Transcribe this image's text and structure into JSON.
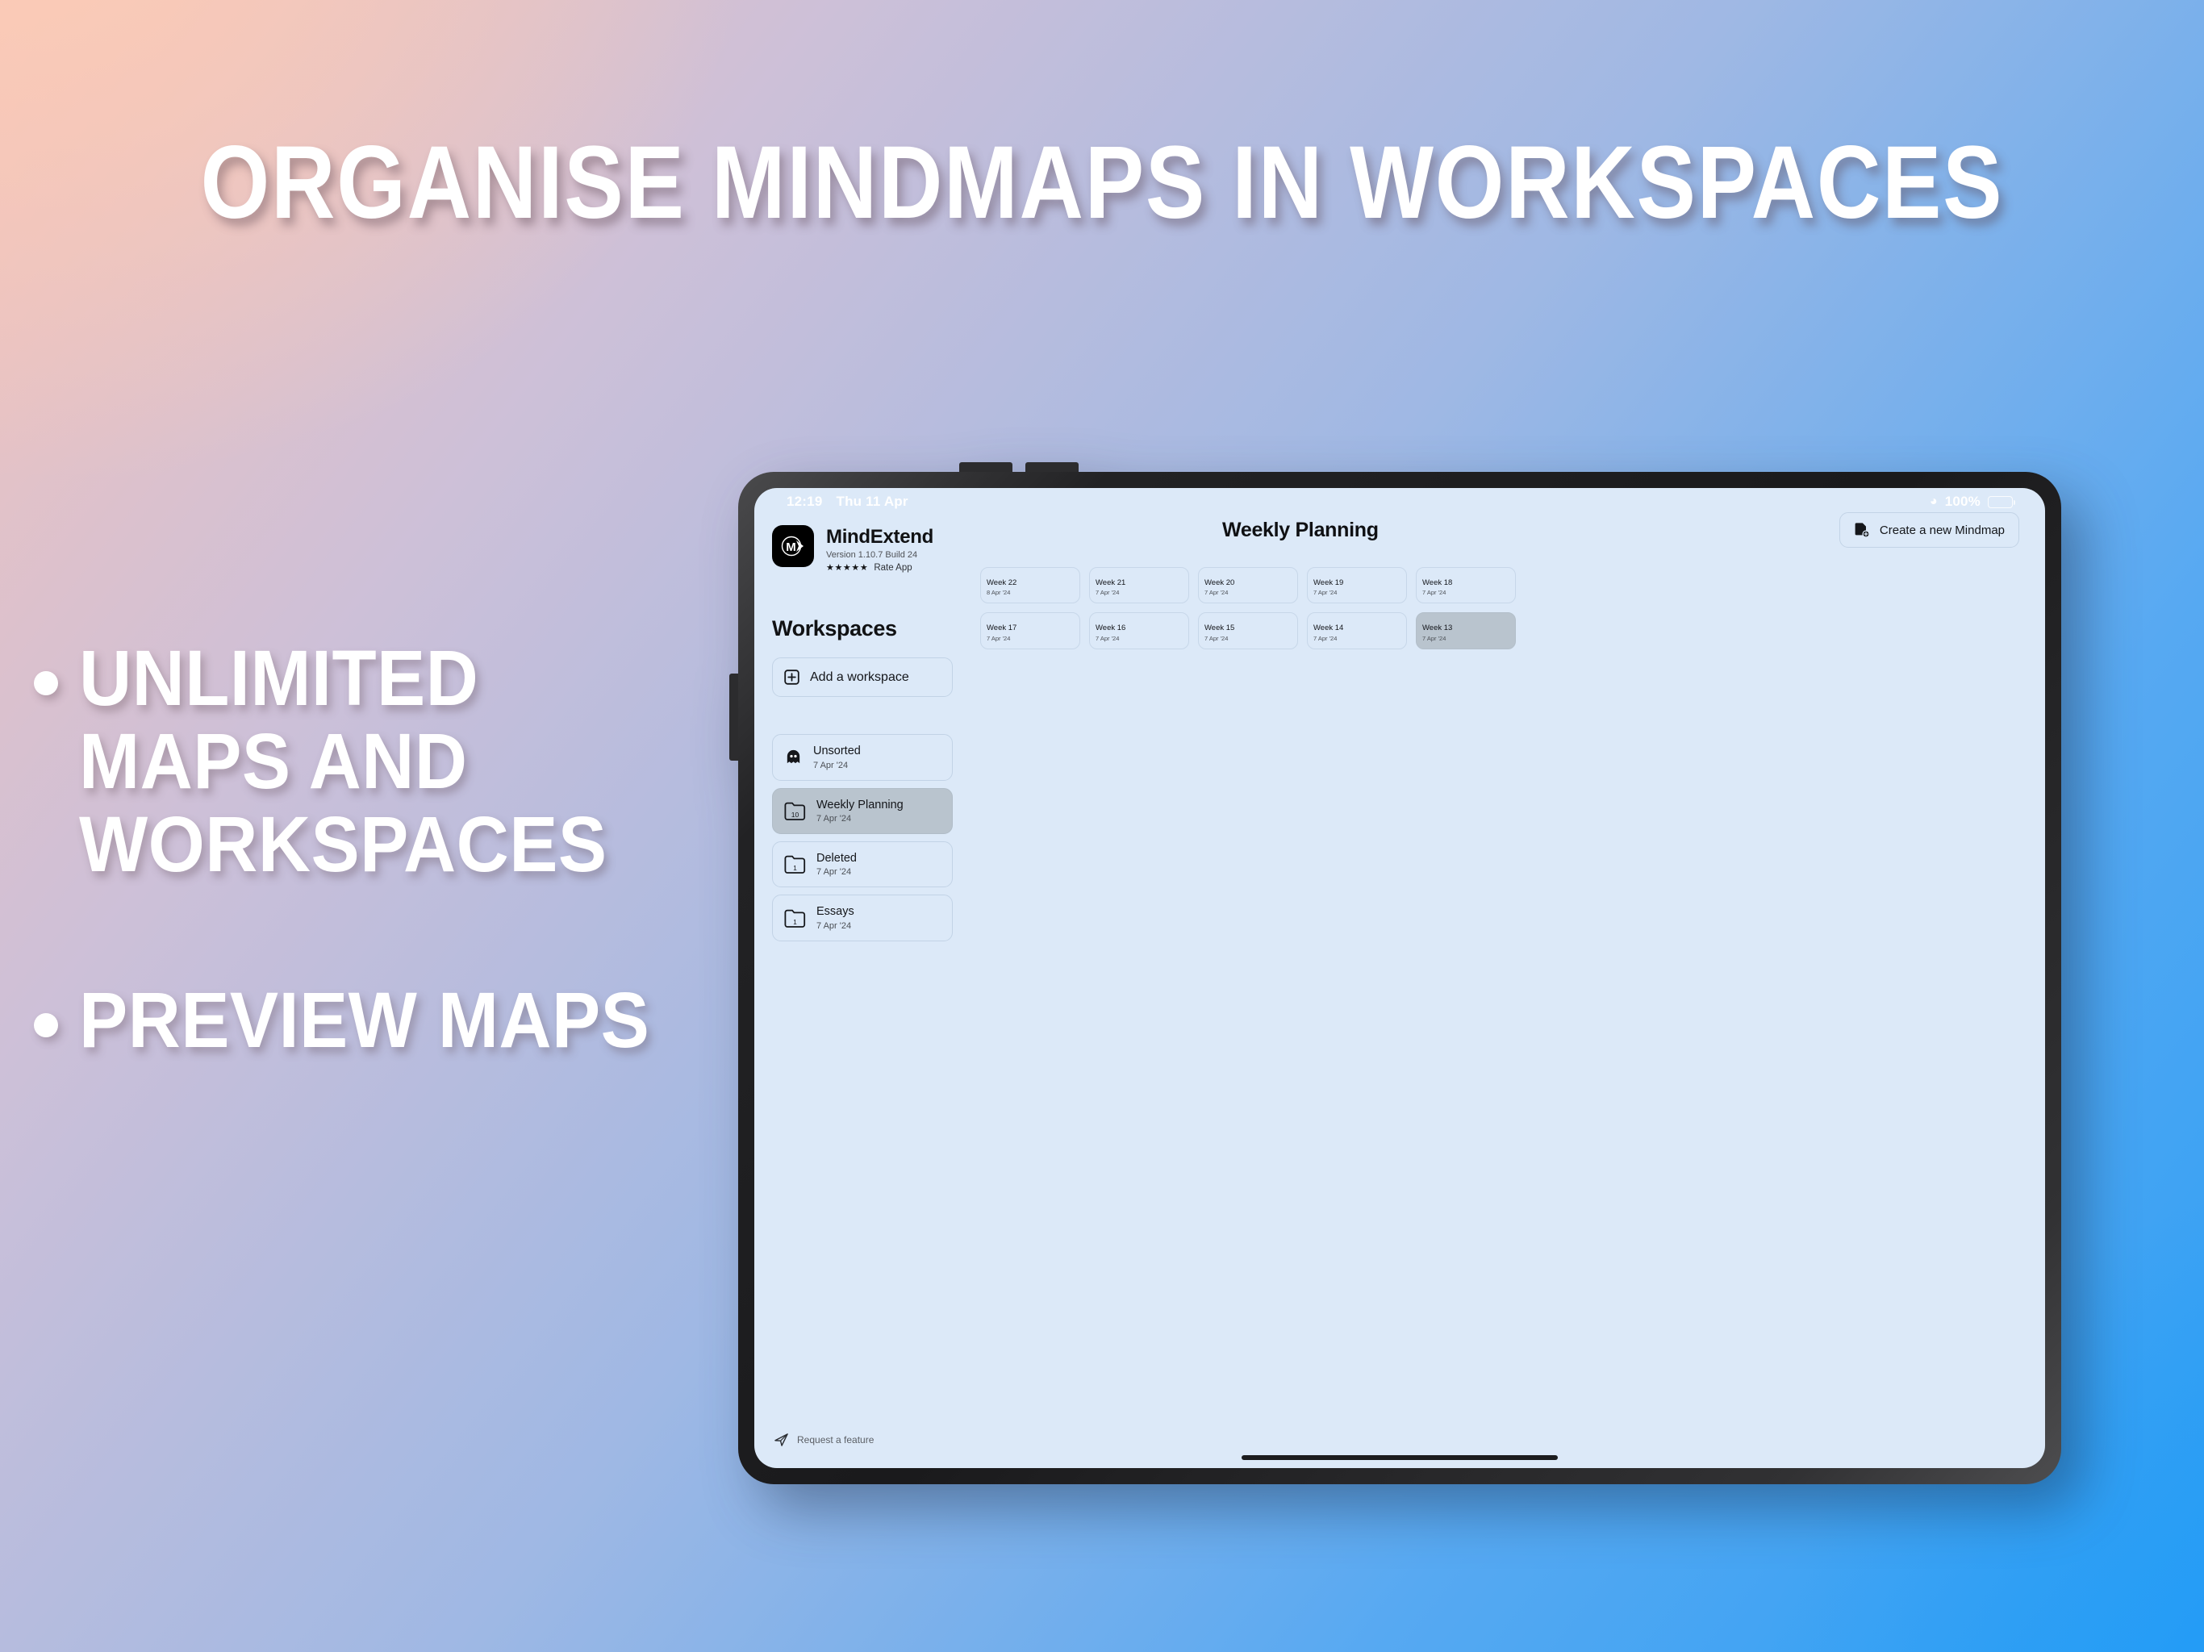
{
  "promo": {
    "headline": "ORGANISE MINDMAPS IN WORKSPACES",
    "bullets": [
      {
        "text": "UNLIMITED MAPS AND WORKSPACES"
      },
      {
        "text": "PREVIEW MAPS"
      }
    ],
    "colors": {
      "background_top_left": "#fbcbb6",
      "background_bottom_right": "#2b9ef4",
      "text": "#ffffff"
    }
  },
  "device": {
    "status_bar": {
      "time": "12:19",
      "date": "Thu 11 Apr",
      "wifi_icon": "wifi-icon",
      "battery_percent": "100%",
      "battery_icon": "battery-full-icon"
    }
  },
  "app": {
    "icon_name": "mindextend-app-icon",
    "name": "MindExtend",
    "version": "Version 1.10.7 Build 24",
    "stars": "★★★★★",
    "rate_app_label": "Rate App"
  },
  "sidebar": {
    "title": "Workspaces",
    "add_workspace": {
      "label": "Add a workspace",
      "icon": "plus-square-icon"
    },
    "items": [
      {
        "label": "Unsorted",
        "date": "7 Apr '24",
        "icon": "ghost-icon",
        "count": "",
        "selected": false
      },
      {
        "label": "Weekly Planning",
        "date": "7 Apr '24",
        "icon": "folder-icon",
        "count": "10",
        "selected": true
      },
      {
        "label": "Deleted",
        "date": "7 Apr '24",
        "icon": "folder-icon",
        "count": "1",
        "selected": false
      },
      {
        "label": "Essays",
        "date": "7 Apr '24",
        "icon": "folder-icon",
        "count": "1",
        "selected": false
      }
    ],
    "request_feature": {
      "label": "Request a feature",
      "icon": "paper-plane-icon"
    }
  },
  "main": {
    "page_title": "Weekly Planning",
    "create_button": {
      "label": "Create a new Mindmap",
      "icon": "document-add-icon"
    },
    "mindmaps": [
      {
        "name": "Week 22",
        "date": "8 Apr '24",
        "thumb": "blue",
        "selected": false
      },
      {
        "name": "Week 21",
        "date": "7 Apr '24",
        "thumb": "blue",
        "selected": false
      },
      {
        "name": "Week 20",
        "date": "7 Apr '24",
        "thumb": "blue",
        "selected": false
      },
      {
        "name": "Week 19",
        "date": "7 Apr '24",
        "thumb": "blue",
        "selected": false
      },
      {
        "name": "Week 18",
        "date": "7 Apr '24",
        "thumb": "blue",
        "selected": false
      },
      {
        "name": "Week 17",
        "date": "7 Apr '24",
        "thumb": "warm",
        "selected": false
      },
      {
        "name": "Week 16",
        "date": "7 Apr '24",
        "thumb": "warm",
        "selected": false
      },
      {
        "name": "Week 15",
        "date": "7 Apr '24",
        "thumb": "warm",
        "selected": false
      },
      {
        "name": "Week 14",
        "date": "7 Apr '24",
        "thumb": "warm",
        "selected": false
      },
      {
        "name": "Week 13",
        "date": "7 Apr '24",
        "thumb": "light",
        "selected": true
      }
    ]
  }
}
